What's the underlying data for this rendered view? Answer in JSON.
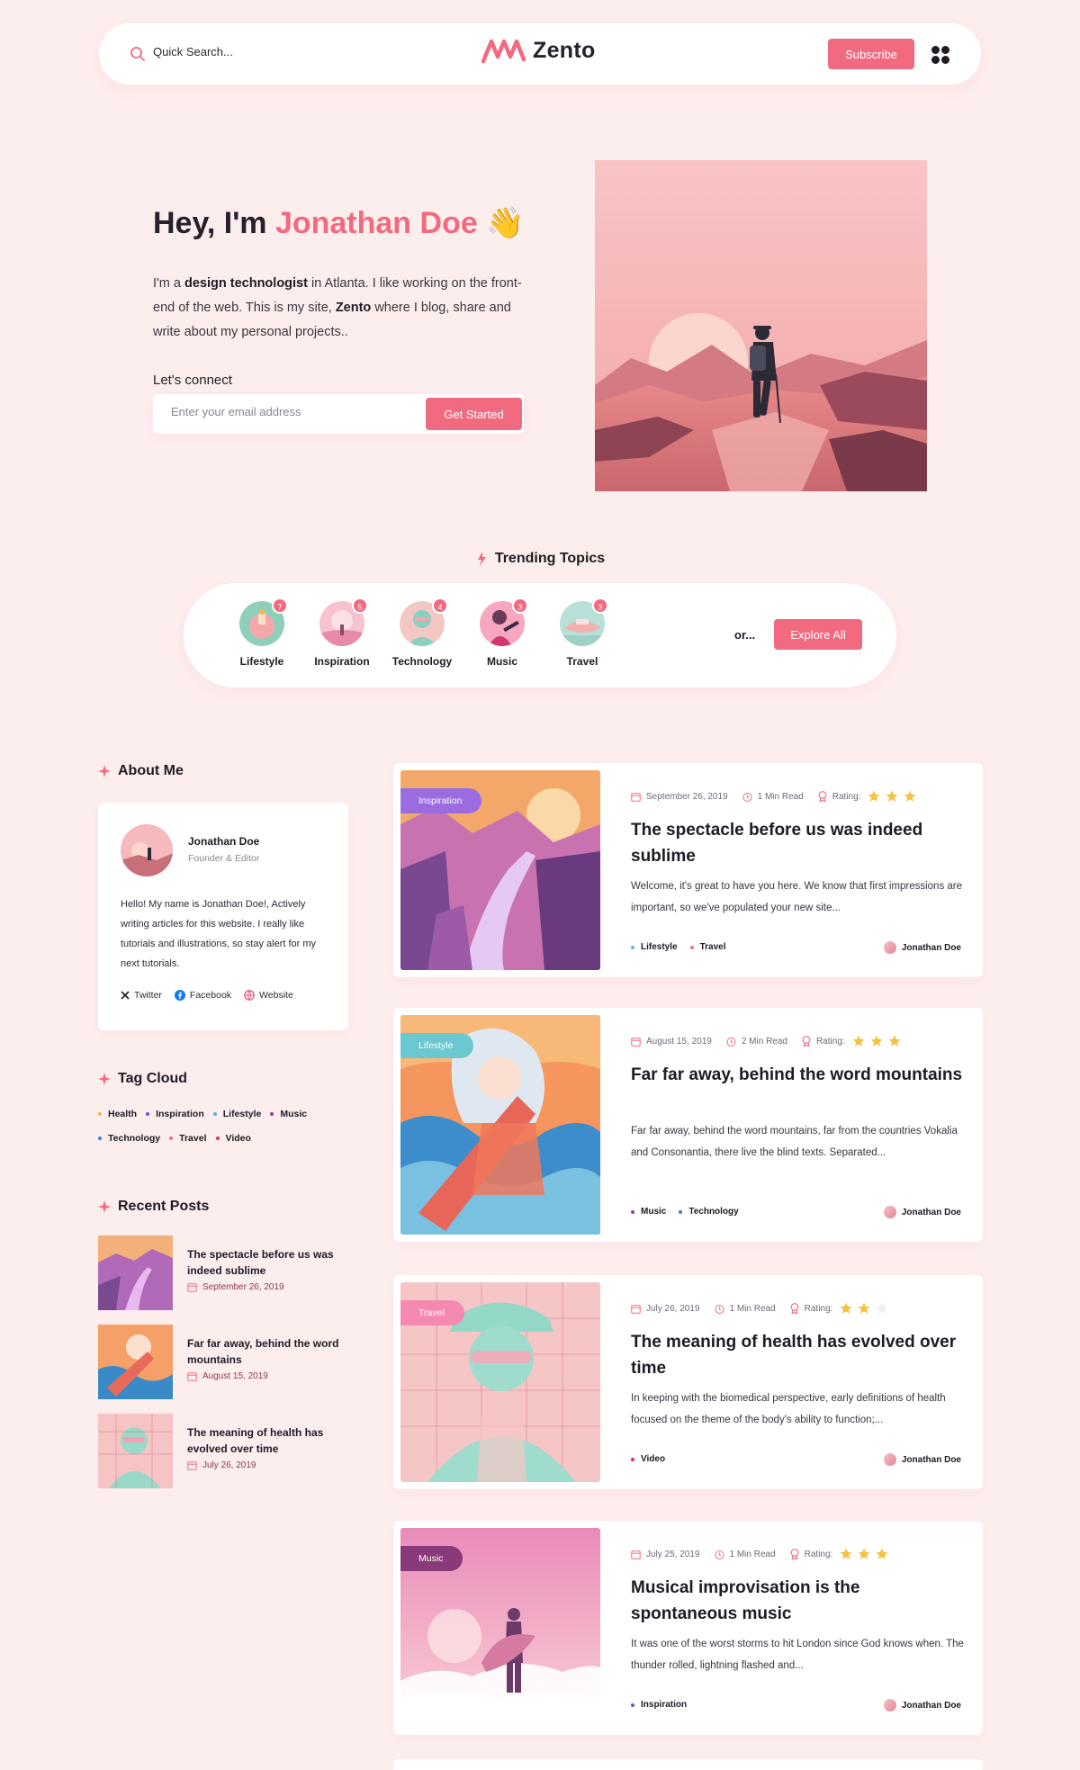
{
  "header": {
    "search_placeholder": "Quick Search...",
    "logo_text": "Zento",
    "subscribe_label": "Subscribe"
  },
  "hero": {
    "greeting": "Hey, I'm ",
    "name": "Jonathan Doe",
    "wave": "👋",
    "intro_1": "I'm a ",
    "intro_bold_1": "design technologist",
    "intro_2": " in Atlanta. I like working on the front-end of the web. This is my site, ",
    "intro_bold_2": "Zento",
    "intro_3": " where I blog, share and write about my personal projects..",
    "connect_label": "Let's connect",
    "email_placeholder": "Enter your email address",
    "cta_label": "Get Started"
  },
  "trending": {
    "title": "Trending Topics",
    "topics": [
      {
        "label": "Lifestyle",
        "count": "7"
      },
      {
        "label": "Inspiration",
        "count": "5"
      },
      {
        "label": "Technology",
        "count": "4"
      },
      {
        "label": "Music",
        "count": "3"
      },
      {
        "label": "Travel",
        "count": "3"
      }
    ],
    "or_text": "or...",
    "explore_label": "Explore All"
  },
  "sidebar": {
    "about_title": "About Me",
    "about_name": "Jonathan Doe",
    "about_role": "Founder & Editor",
    "about_bio": "Hello! My name is Jonathan Doe!, Actively writing articles for this website. I really like tutorials and illustrations, so stay alert for my next tutorials.",
    "socials": [
      "Twitter",
      "Facebook",
      "Website"
    ],
    "tag_title": "Tag Cloud",
    "tags": [
      {
        "label": "Health",
        "color": "#f0b840"
      },
      {
        "label": "Inspiration",
        "color": "#7a4fd0"
      },
      {
        "label": "Lifestyle",
        "color": "#5ab8d8"
      },
      {
        "label": "Music",
        "color": "#9a3aa0"
      },
      {
        "label": "Technology",
        "color": "#3a7ad8"
      },
      {
        "label": "Travel",
        "color": "#f06aa0"
      },
      {
        "label": "Video",
        "color": "#e03060"
      }
    ],
    "recent_title": "Recent Posts",
    "recent": [
      {
        "title": "The spectacle before us was indeed sublime",
        "date": "September 26, 2019"
      },
      {
        "title": "Far far away, behind the word mountains",
        "date": "August 15, 2019"
      },
      {
        "title": "The meaning of health has evolved over time",
        "date": "July 26, 2019"
      }
    ]
  },
  "rating_label": "Rating:",
  "author_name": "Jonathan Doe",
  "posts": [
    {
      "badge": "Inspiration",
      "badge_color": "#9b6ce0",
      "date": "September 26, 2019",
      "read": "1 Min Read",
      "stars": 3,
      "title": "The spectacle before us was indeed sublime",
      "excerpt": "Welcome, it's great to have you here. We know that first impressions are important, so we've populated your new site...",
      "tags": [
        {
          "label": "Lifestyle",
          "color": "#5ab8d8"
        },
        {
          "label": "Travel",
          "color": "#f06aa0"
        }
      ]
    },
    {
      "badge": "Lifestyle",
      "badge_color": "#6cc8d0",
      "date": "August 15, 2019",
      "read": "2 Min Read",
      "stars": 3,
      "title": "Far far away, behind the word mountains",
      "excerpt": "Far far away, behind the word mountains, far from the countries Vokalia and Consonantia, there live the blind texts. Separated...",
      "tags": [
        {
          "label": "Music",
          "color": "#9a3aa0"
        },
        {
          "label": "Technology",
          "color": "#3a7ad8"
        }
      ]
    },
    {
      "badge": "Travel",
      "badge_color": "#f58ab0",
      "date": "July 26, 2019",
      "read": "1 Min Read",
      "stars": 2,
      "title": "The meaning of health has evolved over time",
      "excerpt": "In keeping with the biomedical perspective, early definitions of health focused on the theme of the body's ability to function;...",
      "tags": [
        {
          "label": "Video",
          "color": "#e03060"
        }
      ]
    },
    {
      "badge": "Music",
      "badge_color": "#8a3a7a",
      "date": "July 25, 2019",
      "read": "1 Min Read",
      "stars": 3,
      "title": "Musical improvisation is the spontaneous music",
      "excerpt": "It was one of the worst storms to hit London since God knows when. The thunder rolled, lightning flashed and...",
      "tags": [
        {
          "label": "Inspiration",
          "color": "#7a4fd0"
        }
      ]
    }
  ]
}
